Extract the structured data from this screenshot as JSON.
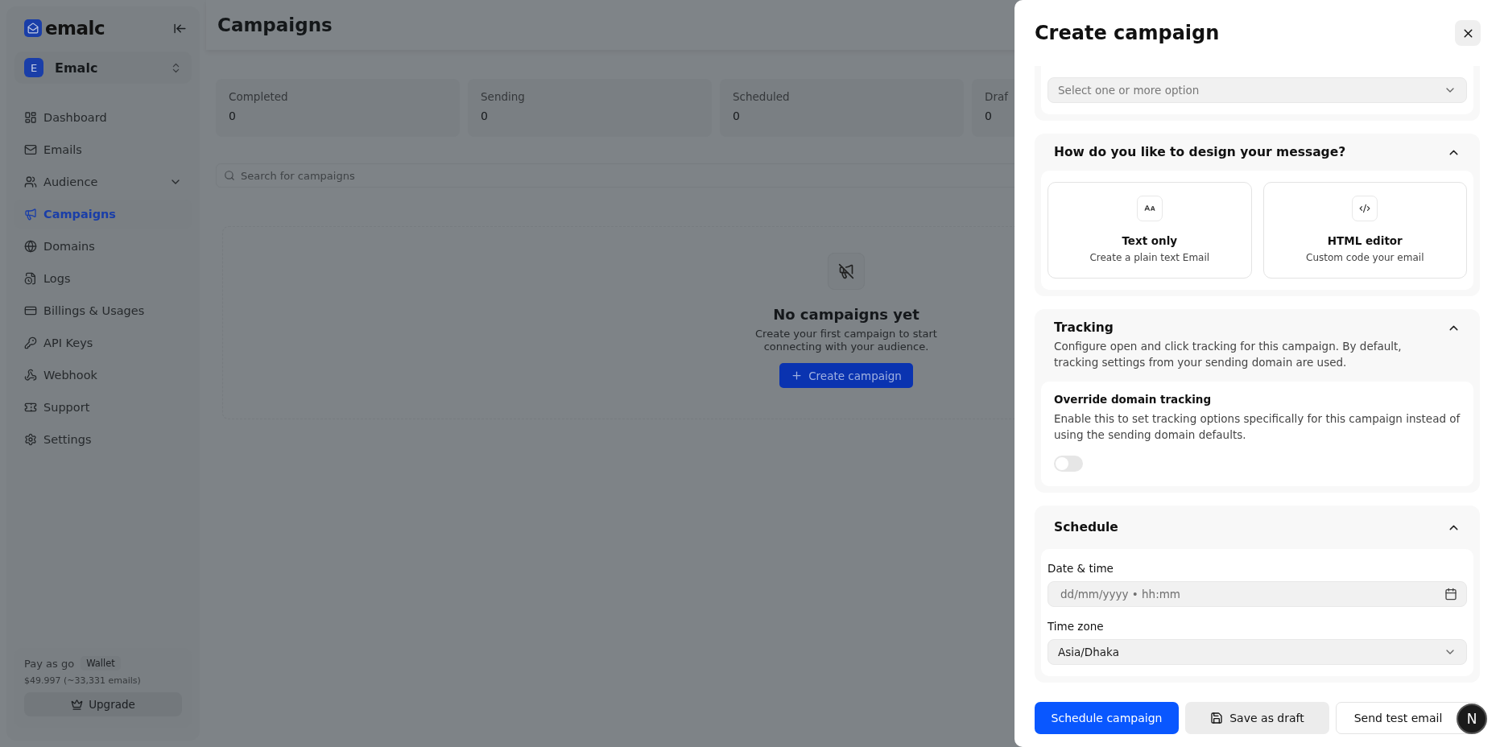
{
  "sidebar": {
    "logo": "emalc",
    "workspace": {
      "initial": "E",
      "name": "Emalc"
    },
    "items": [
      {
        "label": "Dashboard",
        "kind": "link",
        "selected": false
      },
      {
        "label": "Emails",
        "kind": "link",
        "selected": false
      },
      {
        "label": "Audience",
        "kind": "group",
        "expanded": false,
        "selected": false
      },
      {
        "label": "Campaigns",
        "kind": "link",
        "selected": true
      },
      {
        "label": "Domains",
        "kind": "link",
        "selected": false
      },
      {
        "label": "Logs",
        "kind": "link",
        "selected": false
      },
      {
        "label": "Billings & Usages",
        "kind": "link",
        "selected": false
      },
      {
        "label": "API Keys",
        "kind": "link",
        "selected": false
      },
      {
        "label": "Webhook",
        "kind": "link",
        "selected": false
      },
      {
        "label": "Support",
        "kind": "link",
        "selected": false
      },
      {
        "label": "Settings",
        "kind": "link",
        "selected": false
      }
    ],
    "plan": {
      "label": "Pay as go",
      "badge": "Wallet",
      "balance": "$49.997 (~33,331 emails)",
      "button": "Upgrade"
    }
  },
  "main": {
    "title": "Campaigns",
    "stats": [
      {
        "label": "Completed",
        "value": "0"
      },
      {
        "label": "Sending",
        "value": "0"
      },
      {
        "label": "Scheduled",
        "value": "0"
      },
      {
        "label": "Draf",
        "value": "0"
      }
    ],
    "search": {
      "placeholder": "Search for campaigns"
    },
    "empty": {
      "title": "No campaigns yet",
      "text": "Create your first campaign to start connecting with your audience.",
      "button": "Create campaign"
    }
  },
  "drawer": {
    "title": "Create campaign",
    "exclude": {
      "placeholder": "Select one or more option"
    },
    "design": {
      "title": "How do you like to design your message?",
      "expanded": true,
      "options": [
        {
          "title": "Text only",
          "text": "Create a plain text Email",
          "selected": false
        },
        {
          "title": "HTML editor",
          "text": "Custom code your email",
          "selected": false
        }
      ]
    },
    "tracking": {
      "title": "Tracking",
      "expanded": true,
      "description": "Configure open and click tracking for this campaign. By default, tracking settings from your sending domain are used.",
      "override": {
        "title": "Override domain tracking",
        "description": "Enable this to set tracking options specifically for this campaign instead of using the sending domain defaults.",
        "on": false
      }
    },
    "schedule": {
      "title": "Schedule",
      "expanded": true,
      "date_label": "Date & time",
      "date_placeholder": "dd/mm/yyyy • hh:mm",
      "timezone_label": "Time zone",
      "timezone": "Asia/Dhaka"
    },
    "actions": [
      {
        "label": "Schedule campaign",
        "kind": "primary"
      },
      {
        "label": "Save as draft",
        "kind": "secondary"
      },
      {
        "label": "Send test email",
        "kind": "outline"
      }
    ]
  },
  "avatar": {
    "initial": "N"
  }
}
